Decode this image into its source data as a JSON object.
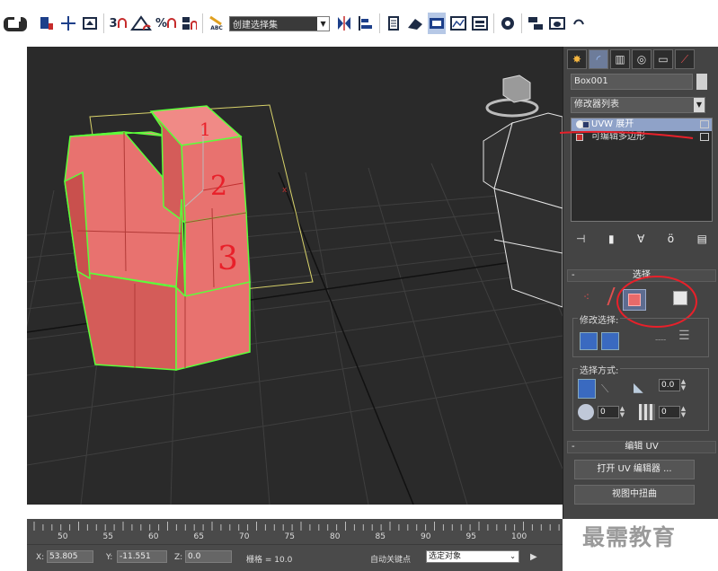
{
  "toolbar": {
    "selection_set": "创建选择集",
    "snap3": "3",
    "snap_pct": "%",
    "abc": "ABC"
  },
  "viewport": {
    "annotations": [
      "1",
      "2",
      "3"
    ]
  },
  "panel": {
    "object_name": "Box001",
    "modifier_list": "修改器列表",
    "stack": [
      {
        "label": "UVW 展开",
        "selected": true
      },
      {
        "label": "可编辑多边形",
        "selected": false
      }
    ],
    "rollout_selection": "选择",
    "modify_selection": "修改选择:",
    "selection_method": "选择方式:",
    "spin_angle": "0.0",
    "spin_a": "0",
    "spin_b": "0",
    "rollout_edit_uv": "编辑 UV",
    "open_uv_editor": "打开 UV 编辑器 ...",
    "tweak_in_view": "视图中扭曲"
  },
  "timeline": {
    "labels": [
      "50",
      "55",
      "60",
      "65",
      "70",
      "75",
      "80",
      "85",
      "90",
      "95",
      "100"
    ]
  },
  "status": {
    "x_label": "X:",
    "x_value": "53.805",
    "y_label": "Y:",
    "y_value": "-11.551",
    "z_label": "Z:",
    "z_value": "0.0",
    "grid": "栅格 = 10.0",
    "autokey": "自动关键点",
    "selected_object": "选定对象"
  },
  "watermark": "最需教育",
  "colors": {
    "viewport_bg": "#2a2a2a",
    "selected_face": "#e8726f",
    "selection_edge": "#5cff3a",
    "annotation_red": "#e8202a"
  }
}
